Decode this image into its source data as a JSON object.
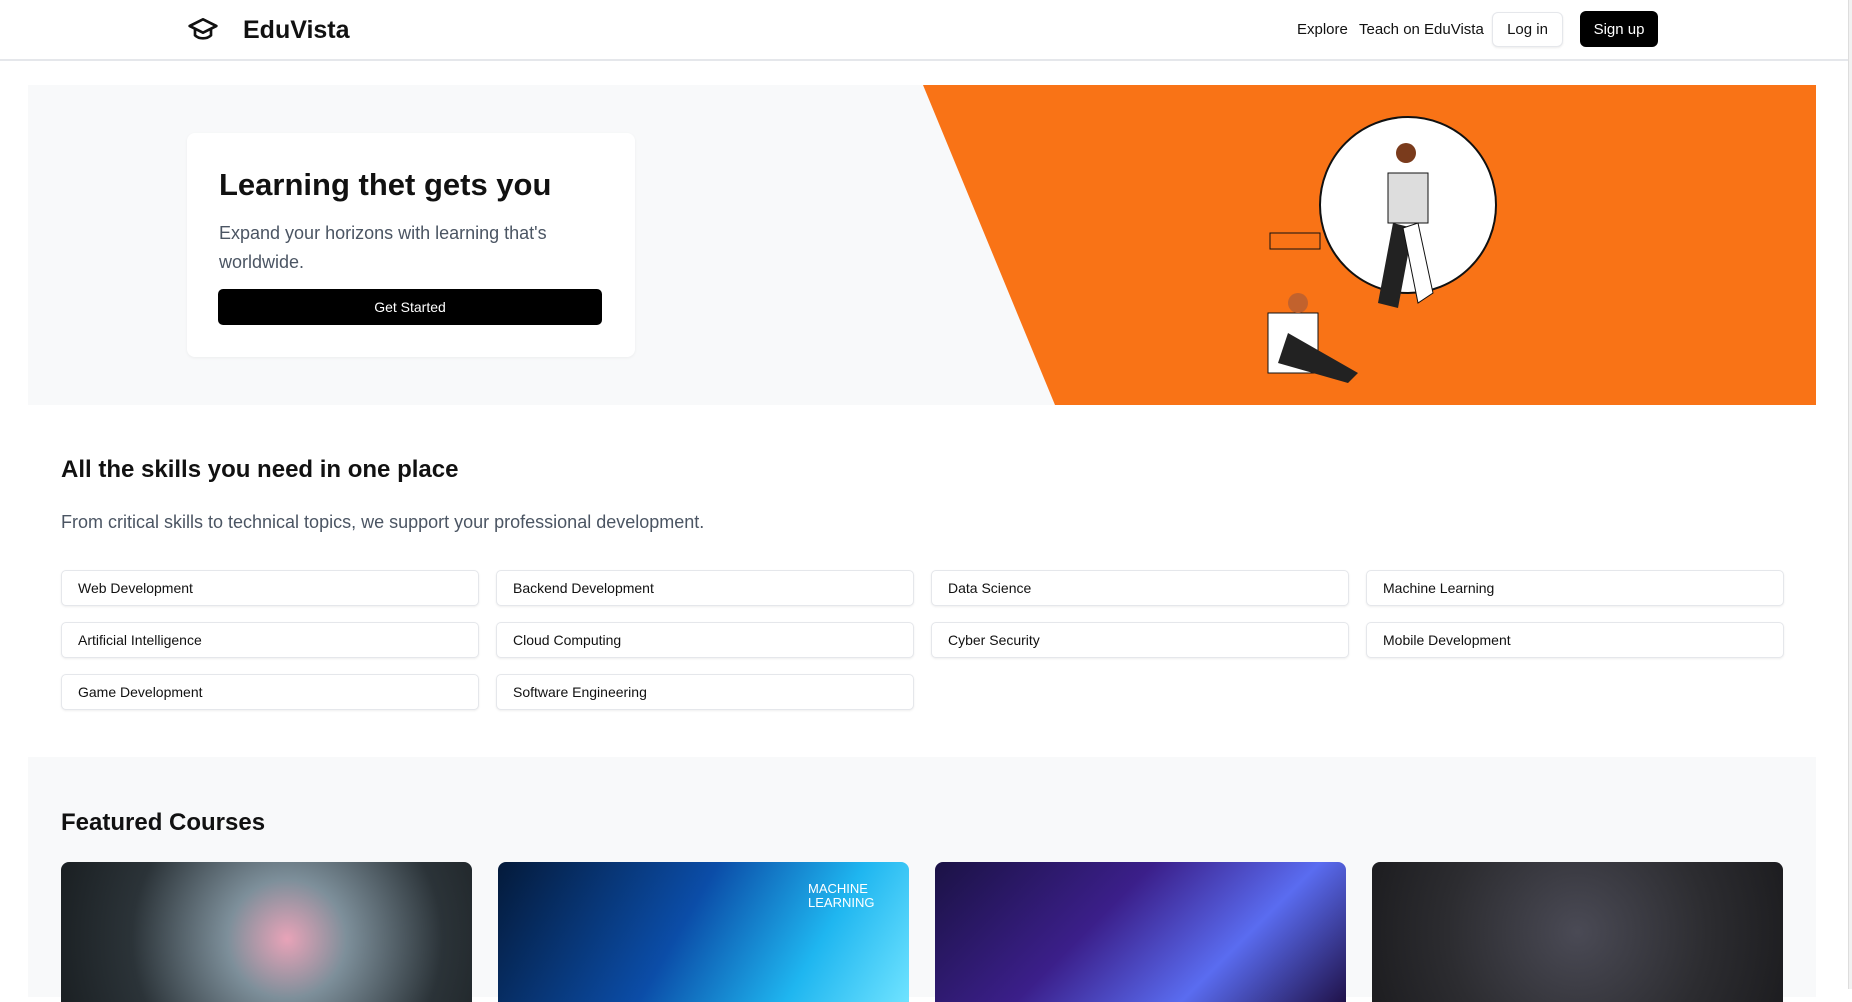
{
  "header": {
    "brand": "EduVista",
    "nav": [
      "Explore",
      "Teach on EduVista"
    ],
    "login": "Log in",
    "signup": "Sign up"
  },
  "hero": {
    "title": "Learning thet gets you",
    "subtitle": "Expand your horizons with learning that's worldwide.",
    "cta": "Get Started",
    "accent": "#F97316"
  },
  "skills": {
    "title": "All the skills you need in one place",
    "subtitle": "From critical skills to technical topics, we support your professional development.",
    "items": [
      "Web Development",
      "Backend Development",
      "Data Science",
      "Machine Learning",
      "Artificial Intelligence",
      "Cloud Computing",
      "Cyber Security",
      "Mobile Development",
      "Game Development",
      "Software Engineering"
    ]
  },
  "featured": {
    "title": "Featured Courses",
    "image_text": "MACHINE LEARNING"
  }
}
